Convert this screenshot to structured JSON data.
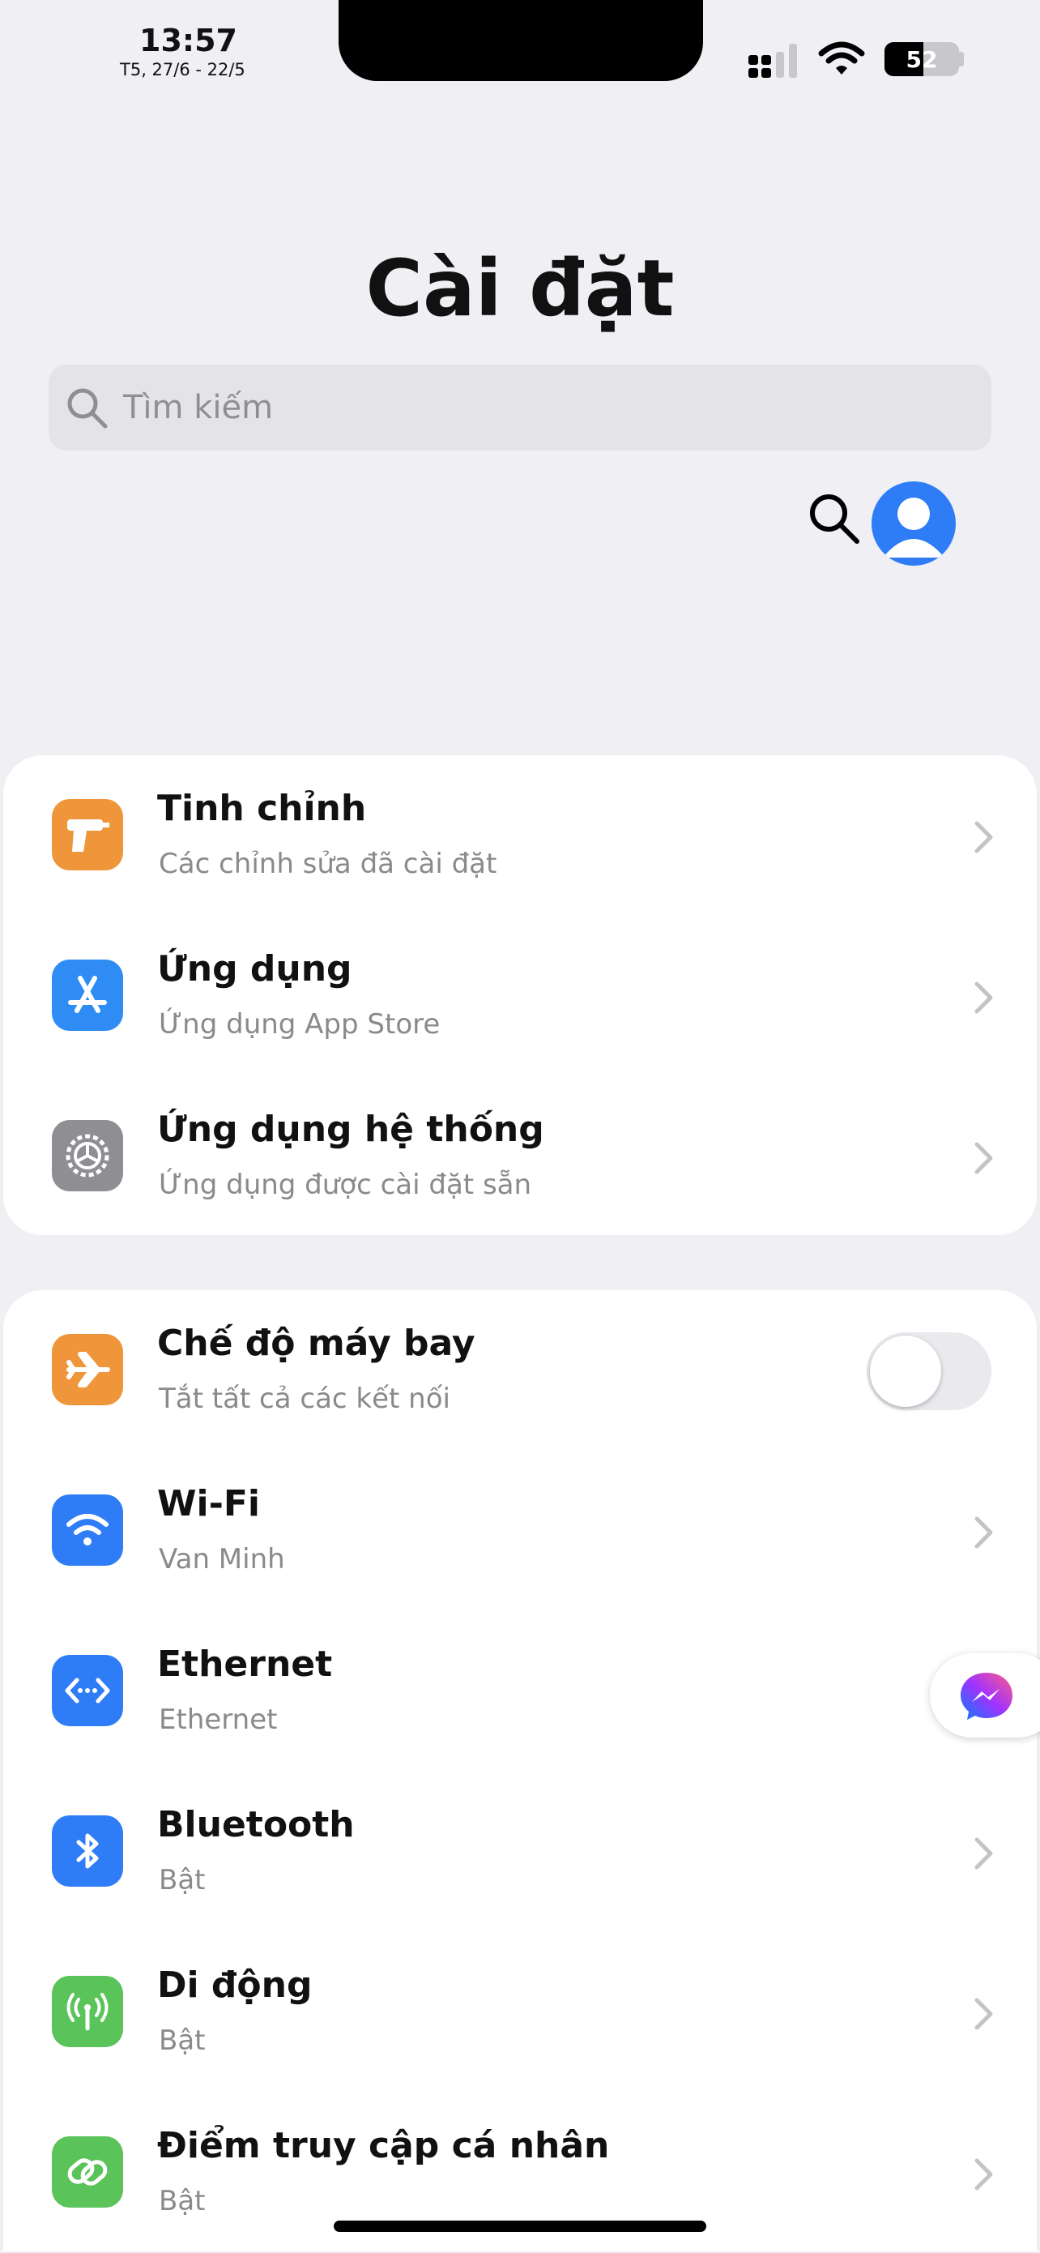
{
  "status_bar": {
    "time": "13:57",
    "date": "T5, 27/6 - 22/5",
    "battery_level": "52",
    "battery_fraction": 0.52
  },
  "header": {
    "title": "Cài đặt",
    "search_placeholder": "Tìm kiếm"
  },
  "groups": [
    {
      "items": [
        {
          "title": "Tinh chỉnh",
          "subtitle": "Các chỉnh sửa đã cài đặt",
          "icon": "drill-icon",
          "color": "#f0963a"
        },
        {
          "title": "Ứng dụng",
          "subtitle": "Ứng dụng App Store",
          "icon": "app-store-icon",
          "color": "#2f8cf4"
        },
        {
          "title": "Ứng dụng hệ thống",
          "subtitle": "Ứng dụng được cài đặt sẵn",
          "icon": "gear-icon",
          "color": "#8e8e93"
        }
      ]
    },
    {
      "items": [
        {
          "title": "Chế độ máy bay",
          "subtitle": "Tắt tất cả các kết nối",
          "icon": "airplane-icon",
          "color": "#f0963a",
          "toggle": false
        },
        {
          "title": "Wi-Fi",
          "subtitle": "Van Minh",
          "icon": "wifi-icon",
          "color": "#2f7df6"
        },
        {
          "title": "Ethernet",
          "subtitle": "Ethernet",
          "icon": "ethernet-icon",
          "color": "#2f7df6"
        },
        {
          "title": "Bluetooth",
          "subtitle": "Bật",
          "icon": "bluetooth-icon",
          "color": "#2f7df6"
        },
        {
          "title": "Di động",
          "subtitle": "Bật",
          "icon": "cellular-icon",
          "color": "#5ac45a"
        },
        {
          "title": "Điểm truy cập cá nhân",
          "subtitle": "Bật",
          "icon": "hotspot-icon",
          "color": "#5ac45a"
        }
      ]
    }
  ]
}
